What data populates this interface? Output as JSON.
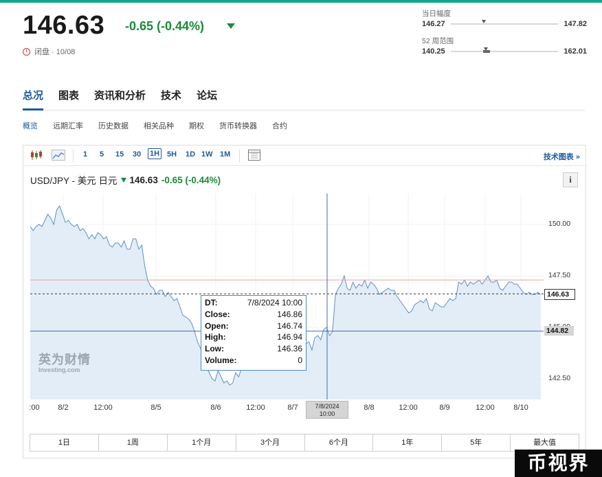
{
  "quote": {
    "price": "146.63",
    "change": "-0.65 (-0.44%)",
    "status": "闭盘 · 10/08"
  },
  "ranges": {
    "day": {
      "label": "当日幅度",
      "low": "146.27",
      "high": "147.82"
    },
    "week52": {
      "label": "52 周范围",
      "low": "140.25",
      "high": "162.01"
    }
  },
  "tabs": [
    "总况",
    "图表",
    "资讯和分析",
    "技术",
    "论坛"
  ],
  "subnav": [
    "概览",
    "远期汇率",
    "历史数据",
    "相关品种",
    "期权",
    "货币转换器",
    "合约"
  ],
  "toolbar": {
    "intervals": [
      "1",
      "5",
      "15",
      "30",
      "1H",
      "5H",
      "1D",
      "1W",
      "1M"
    ],
    "selected": "1H",
    "link": "技术图表 »"
  },
  "chart_header": {
    "symbol": "USD/JPY - 美元 日元",
    "price": "146.63",
    "change": "-0.65 (-0.44%)"
  },
  "tooltip": {
    "rows": [
      {
        "k": "DT:",
        "v": "7/8/2024 10:00"
      },
      {
        "k": "Close:",
        "v": "146.86"
      },
      {
        "k": "Open:",
        "v": "146.74"
      },
      {
        "k": "High:",
        "v": "146.94"
      },
      {
        "k": "Low:",
        "v": "146.36"
      },
      {
        "k": "Volume:",
        "v": "0"
      }
    ]
  },
  "watermark": {
    "cn": "英为财情",
    "en": "Investing.com"
  },
  "periods": [
    "1日",
    "1周",
    "1个月",
    "3个月",
    "6个月",
    "1年",
    "5年",
    "最大值"
  ],
  "stamp": "币视界",
  "colors": {
    "accent": "#1c5a9c",
    "up_green": "#1a8a3c",
    "line": "#5b8fc7",
    "fill": "#e3edf7",
    "top_bar": "#16a58d"
  },
  "chart_data": {
    "type": "area",
    "x_ticks": [
      ":00",
      "8/2",
      "12:00",
      "8/5",
      "8/6",
      "12:00",
      "8/7",
      "8/8",
      "12:00",
      "8/9",
      "12:00",
      "8/10"
    ],
    "crosshair_x_label": [
      "7/8/2024",
      "10:00"
    ],
    "y_ticks": [
      "150.00",
      "147.50",
      "145.00",
      "142.50"
    ],
    "ylim": [
      141.5,
      151.5
    ],
    "last_price_tag": "146.63",
    "crosshair_y_tag": "144.82",
    "red_reference": 147.3,
    "values": [
      149.9,
      149.7,
      149.9,
      150.0,
      149.9,
      150.2,
      150.5,
      150.3,
      150.0,
      150.7,
      150.9,
      150.5,
      150.1,
      150.2,
      150.0,
      149.9,
      150.0,
      149.7,
      149.8,
      149.6,
      149.3,
      149.5,
      149.3,
      149.6,
      149.5,
      149.3,
      149.4,
      149.0,
      148.9,
      149.1,
      149.1,
      148.9,
      149.2,
      148.8,
      148.8,
      149.3,
      149.3,
      148.8,
      149.0,
      148.0,
      147.3,
      147.0,
      146.9,
      146.6,
      146.8,
      146.8,
      146.5,
      146.7,
      146.5,
      146.3,
      146.4,
      146.0,
      145.6,
      145.5,
      145.4,
      145.2,
      144.8,
      144.3,
      144.0,
      143.5,
      143.1,
      142.8,
      142.5,
      142.4,
      142.9,
      142.6,
      142.3,
      142.4,
      142.2,
      142.3,
      142.8,
      142.6,
      143.0,
      143.2,
      143.5,
      144.3,
      144.0,
      144.7,
      145.4,
      145.7,
      145.4,
      145.8,
      146.0,
      146.4,
      146.1,
      145.9,
      146.3,
      146.4,
      146.2,
      146.4,
      146.0,
      145.4,
      145.9,
      145.4,
      144.2,
      144.3,
      143.9,
      144.5,
      144.6,
      144.4,
      144.9,
      145.0,
      144.6,
      144.8,
      146.6,
      146.9,
      147.1,
      147.5,
      146.9,
      146.8,
      147.2,
      146.9,
      147.1,
      147.0,
      147.3,
      146.9,
      147.2,
      147.1,
      146.9,
      146.6,
      146.7,
      146.8,
      146.9,
      146.8,
      146.8,
      146.5,
      146.3,
      146.1,
      145.9,
      145.7,
      145.8,
      146.1,
      146.2,
      146.3,
      146.2,
      146.4,
      145.9,
      145.8,
      146.2,
      146.1,
      146.0,
      146.0,
      146.2,
      146.4,
      146.3,
      146.4,
      147.2,
      147.1,
      147.3,
      147.0,
      147.2,
      147.1,
      147.2,
      147.3,
      147.1,
      147.3,
      147.5,
      147.2,
      147.2,
      147.3,
      146.9,
      146.8,
      147.0,
      147.2,
      147.2,
      147.1,
      147.1,
      146.9,
      146.7,
      146.6,
      146.7,
      146.6,
      146.6,
      146.7,
      146.6
    ]
  }
}
